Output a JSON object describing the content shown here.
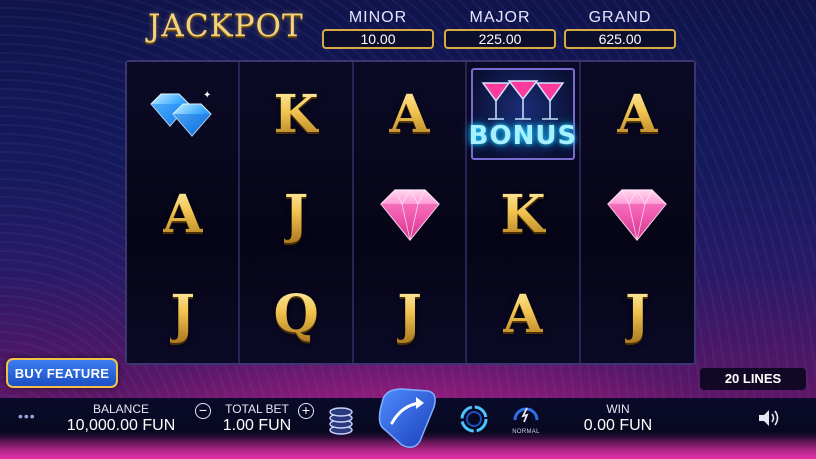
{
  "jackpot": {
    "title": "JACKPOT",
    "minor": {
      "label": "MINOR",
      "value": "10.00"
    },
    "major": {
      "label": "MAJOR",
      "value": "225.00"
    },
    "grand": {
      "label": "GRAND",
      "value": "625.00"
    }
  },
  "reels": [
    [
      "blue-diamonds",
      "A",
      "J"
    ],
    [
      "K",
      "J",
      "Q"
    ],
    [
      "A",
      "pink-diamond",
      "J"
    ],
    [
      "bonus-cocktails",
      "K",
      "A"
    ],
    [
      "A",
      "pink-diamond",
      "J"
    ]
  ],
  "bonus_text": "BONUS",
  "buy_feature": "BUY FEATURE",
  "lines": "20 LINES",
  "balance": {
    "label": "BALANCE",
    "value": "10,000.00 FUN"
  },
  "total_bet": {
    "label": "TOTAL BET",
    "value": "1.00 FUN"
  },
  "win": {
    "label": "WIN",
    "value": "0.00 FUN"
  },
  "speed_label": "NORMAL",
  "menu_dots": "•••",
  "colors": {
    "gold": "#f2c44f",
    "accent_blue": "#2a66e8",
    "pink": "#ff49b0"
  },
  "icons": [
    "menu-dots-icon",
    "minus-icon",
    "plus-icon",
    "coin-stack-icon",
    "spin-arrow-icon",
    "autoplay-icon",
    "speed-gauge-icon",
    "sound-icon"
  ]
}
